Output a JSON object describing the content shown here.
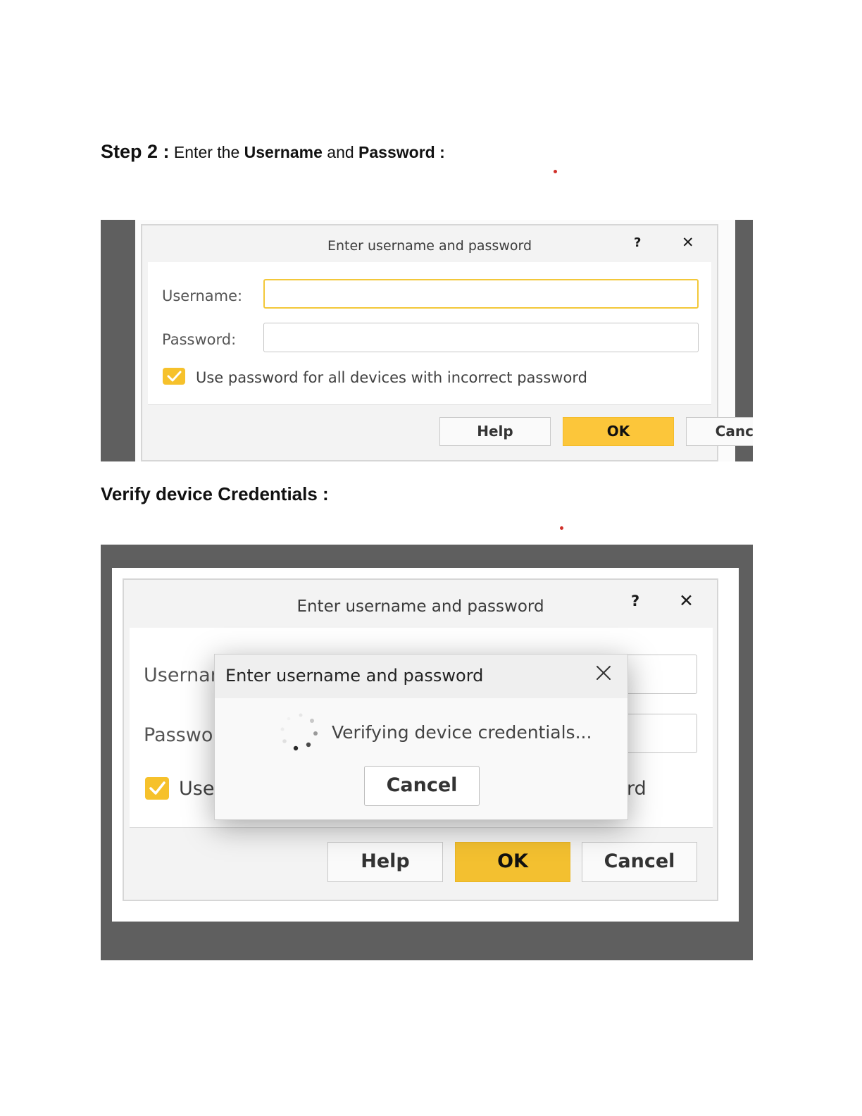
{
  "step_heading": {
    "step": "Step 2 :",
    "text1": "Enter the",
    "bold1": "Username",
    "text2": "and",
    "bold2": "Password",
    "text3": ":"
  },
  "verify_heading": "Verify device Credentials :",
  "dialog1": {
    "title": "Enter username and password",
    "help_icon": "?",
    "close_icon": "✕",
    "username_label": "Username:",
    "password_label": "Password:",
    "username_value": "",
    "password_value": "",
    "checkbox_label": "Use password for all devices with incorrect password",
    "checkbox_checked": true,
    "buttons": {
      "help": "Help",
      "ok": "OK",
      "cancel": "Cancel"
    }
  },
  "dialog2": {
    "title": "Enter username and password",
    "help_icon": "?",
    "close_icon": "✕",
    "username_label_partial": "Usernan",
    "password_label_partial": "Passwor",
    "checkbox_label_partial": "Use",
    "checkbox_label_tail": "rd",
    "buttons": {
      "help": "Help",
      "ok": "OK",
      "cancel": "Cancel"
    },
    "popup": {
      "title": "Enter username and password",
      "message": "Verifying device credentials...",
      "cancel": "Cancel"
    }
  },
  "colors": {
    "accent_yellow": "#fcc63a",
    "dark_frame": "#5f5f5f",
    "marker_red": "#d0302a"
  }
}
